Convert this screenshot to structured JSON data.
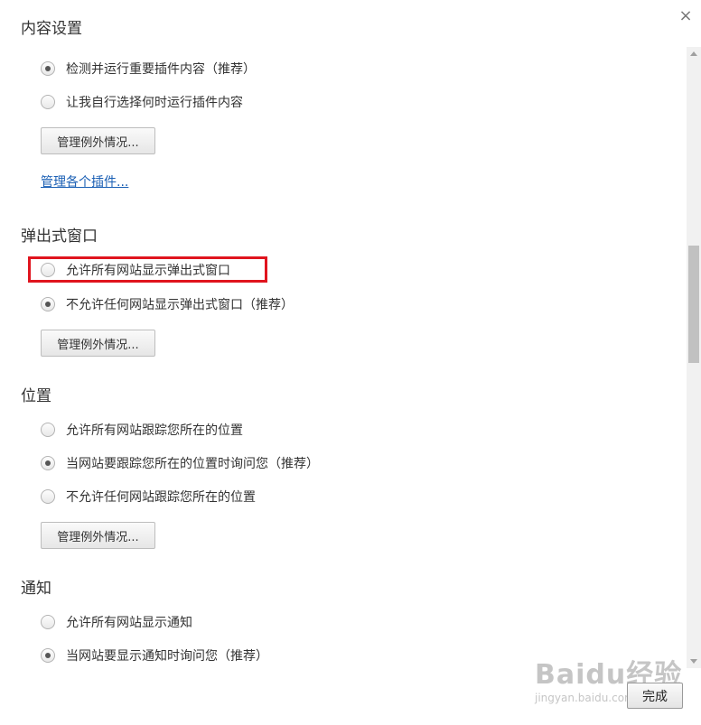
{
  "dialog": {
    "title": "内容设置",
    "close_label": "×"
  },
  "plugins": {
    "options": [
      {
        "label": "检测并运行重要插件内容（推荐）",
        "checked": true
      },
      {
        "label": "让我自行选择何时运行插件内容",
        "checked": false
      }
    ],
    "manage_exceptions": "管理例外情况...",
    "manage_plugins_link": "管理各个插件..."
  },
  "popups": {
    "heading": "弹出式窗口",
    "options": [
      {
        "label": "允许所有网站显示弹出式窗口",
        "checked": false,
        "highlighted": true
      },
      {
        "label": "不允许任何网站显示弹出式窗口（推荐）",
        "checked": true
      }
    ],
    "manage_exceptions": "管理例外情况..."
  },
  "location": {
    "heading": "位置",
    "options": [
      {
        "label": "允许所有网站跟踪您所在的位置",
        "checked": false
      },
      {
        "label": "当网站要跟踪您所在的位置时询问您（推荐）",
        "checked": true
      },
      {
        "label": "不允许任何网站跟踪您所在的位置",
        "checked": false
      }
    ],
    "manage_exceptions": "管理例外情况..."
  },
  "notifications": {
    "heading": "通知",
    "options": [
      {
        "label": "允许所有网站显示通知",
        "checked": false
      },
      {
        "label": "当网站要显示通知时询问您（推荐）",
        "checked": true
      }
    ]
  },
  "footer": {
    "done_label": "完成"
  },
  "watermark": {
    "text": "Baidu经验",
    "sub": "jingyan.baidu.com"
  },
  "colors": {
    "highlight": "#e0141e",
    "link": "#1a5fb4"
  }
}
